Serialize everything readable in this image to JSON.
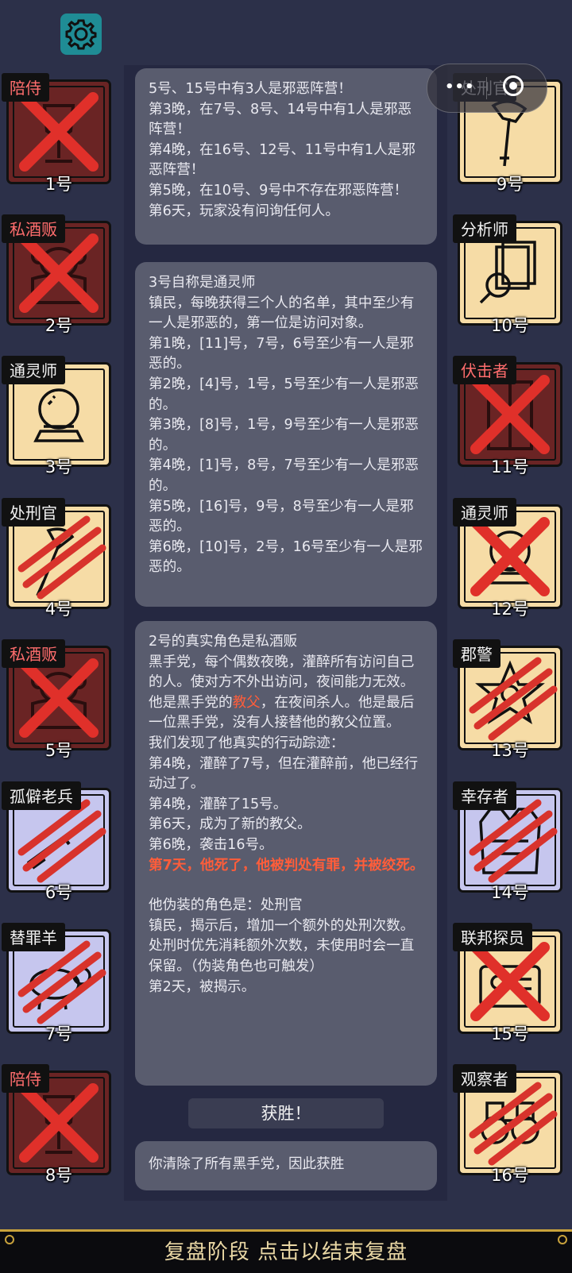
{
  "top": {
    "settings_icon": "gear-icon",
    "menu_dots": "•••"
  },
  "players_left": [
    {
      "number": "1号",
      "role": "陪侍",
      "faction": "mafia",
      "status": "dead",
      "mark": "x",
      "icon": "wine-glass-icon"
    },
    {
      "number": "2号",
      "role": "私酒贩",
      "faction": "mafia",
      "status": "dead",
      "mark": "x",
      "icon": "bootlegger-icon"
    },
    {
      "number": "3号",
      "role": "通灵师",
      "faction": "town",
      "status": "alive",
      "mark": "",
      "icon": "crystal-ball-icon"
    },
    {
      "number": "4号",
      "role": "处刑官",
      "faction": "town",
      "status": "dead",
      "mark": "claw",
      "icon": "axe-icon"
    },
    {
      "number": "5号",
      "role": "私酒贩",
      "faction": "mafia",
      "status": "dead",
      "mark": "x",
      "icon": "bootlegger-icon"
    },
    {
      "number": "6号",
      "role": "孤僻老兵",
      "faction": "town",
      "status": "dead",
      "mark": "claw",
      "icon": "rifle-icon"
    },
    {
      "number": "7号",
      "role": "替罪羊",
      "faction": "town",
      "status": "dead",
      "mark": "claw",
      "icon": "sheep-icon"
    },
    {
      "number": "8号",
      "role": "陪侍",
      "faction": "mafia",
      "status": "dead",
      "mark": "x",
      "icon": "wine-glass-icon"
    }
  ],
  "players_right": [
    {
      "number": "9号",
      "role": "处刑官",
      "faction": "town",
      "status": "alive",
      "mark": "",
      "icon": "axe-icon"
    },
    {
      "number": "10号",
      "role": "分析师",
      "faction": "town",
      "status": "alive",
      "mark": "",
      "icon": "documents-magnifier-icon"
    },
    {
      "number": "11号",
      "role": "伏击者",
      "faction": "mafia",
      "status": "dead",
      "mark": "x",
      "icon": "door-icon"
    },
    {
      "number": "12号",
      "role": "通灵师",
      "faction": "town",
      "status": "dead",
      "mark": "x",
      "icon": "crystal-ball-icon"
    },
    {
      "number": "13号",
      "role": "郡警",
      "faction": "town",
      "status": "dead",
      "mark": "claw",
      "icon": "sheriff-badge-icon"
    },
    {
      "number": "14号",
      "role": "幸存者",
      "faction": "town",
      "status": "dead",
      "mark": "claw",
      "icon": "vest-icon"
    },
    {
      "number": "15号",
      "role": "联邦探员",
      "faction": "town",
      "status": "dead",
      "mark": "x",
      "icon": "agent-icon"
    },
    {
      "number": "16号",
      "role": "观察者",
      "faction": "town",
      "status": "dead",
      "mark": "claw",
      "icon": "binoculars-icon"
    }
  ],
  "messages": {
    "m1": [
      "5号、15号中有3人是邪恶阵营！",
      "第3晚，在7号、8号、14号中有1人是邪恶阵营！",
      "第4晚，在16号、12号、11号中有1人是邪恶阵营！",
      "第5晚，在10号、9号中不存在邪恶阵营！",
      "第6天，玩家没有问询任何人。"
    ],
    "m2": [
      "3号自称是通灵师",
      "镇民，每晚获得三个人的名单，其中至少有一人是邪恶的，第一位是访问对象。",
      "第1晚，[11]号，7号，6号至少有一人是邪恶的。",
      "第2晚，[4]号，1号，5号至少有一人是邪恶的。",
      "第3晚，[8]号，1号，9号至少有一人是邪恶的。",
      "第4晚，[1]号，8号，7号至少有一人是邪恶的。",
      "第5晚，[16]号，9号，8号至少有一人是邪恶的。",
      "第6晚，[10]号，2号，16号至少有一人是邪恶的。"
    ],
    "m3": {
      "line1": "2号的真实角色是私酒贩",
      "line2": "黑手党，每个偶数夜晚，灌醉所有访问自己的人。使对方不外出访问，夜间能力无效。",
      "line3a": "他是黑手党的",
      "line3b": "教父",
      "line3c": "，在夜间杀人。他是最后一位黑手党，没有人接替他的教父位置。",
      "line4": "我们发现了他真实的行动踪迹：",
      "line5": "第4晚，灌醉了7号，但在灌醉前，他已经行动过了。",
      "line6": "第4晚，灌醉了15号。",
      "line7": "第6天，成为了新的教父。",
      "line8": "第6晚，袭击16号。",
      "line9": "第7天，他死了，他被判处有罪，并被绞死。",
      "line10": "他伪装的角色是：处刑官",
      "line11": "镇民，揭示后，增加一个额外的处刑次数。处刑时优先消耗额外次数，未使用时会一直保留。（伪装角色也可触发）",
      "line12": "第2天，被揭示。"
    },
    "victory": "获胜！",
    "m4": "你清除了所有黑手党，因此获胜"
  },
  "bottom_bar": "复盘阶段 点击以结束复盘",
  "colors": {
    "background": "#2c3049",
    "mafia_label": "#ff6d6d",
    "highlight": "#ff5d3a",
    "gold": "#c9a23c",
    "settings": "#1f8c95"
  }
}
